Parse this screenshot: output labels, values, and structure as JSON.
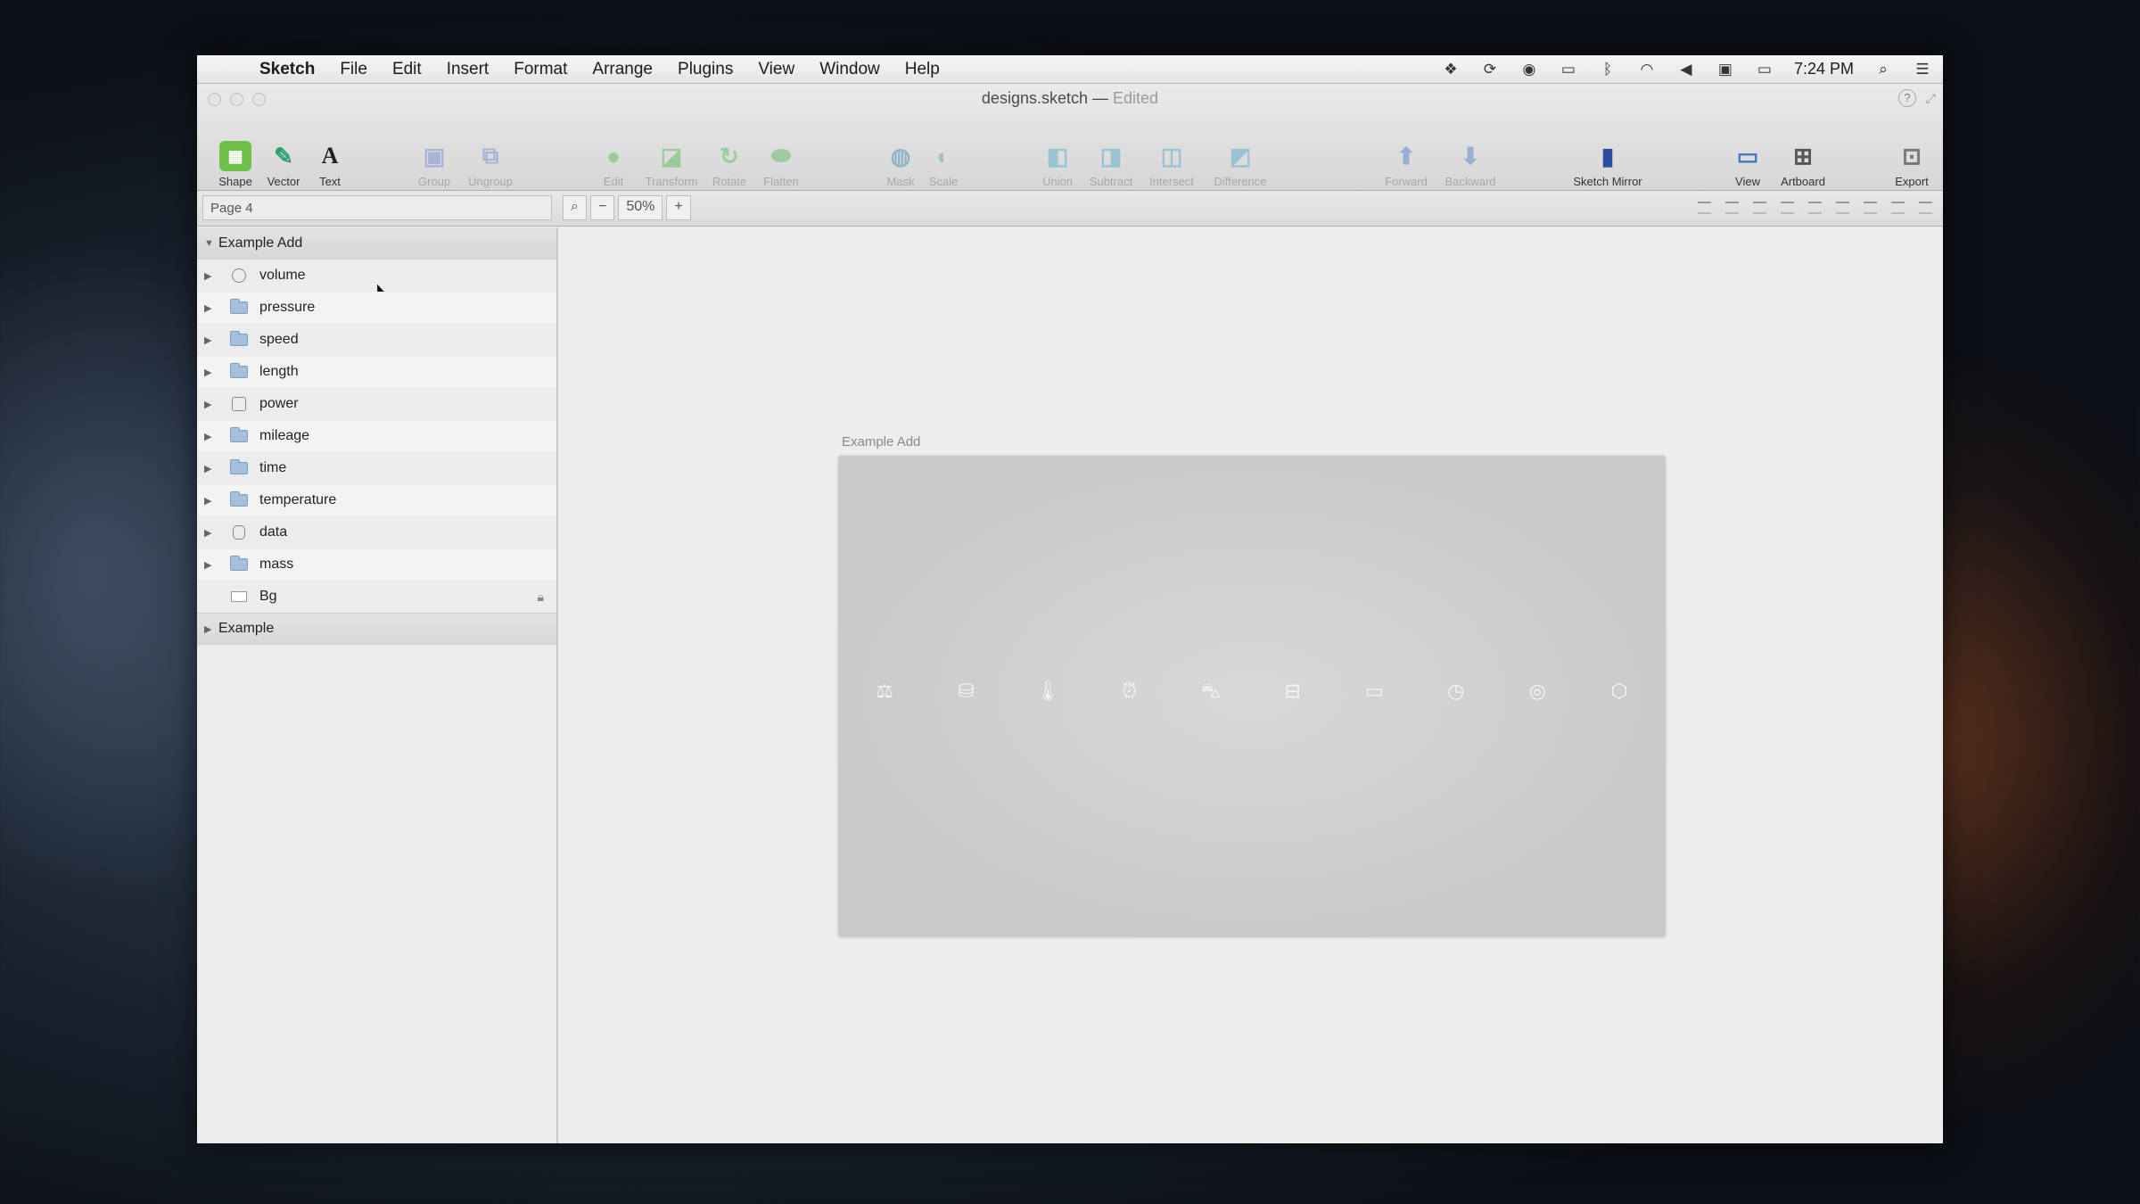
{
  "menubar": {
    "app": "Sketch",
    "items": [
      "File",
      "Edit",
      "Insert",
      "Format",
      "Arrange",
      "Plugins",
      "View",
      "Window",
      "Help"
    ],
    "clock": "7:24 PM",
    "status_icons": [
      "dropbox-icon",
      "sync-icon",
      "record-icon",
      "airplay-icon",
      "bluetooth-icon",
      "wifi-icon",
      "volume-icon",
      "display-icon",
      "battery-icon",
      "spotlight-icon",
      "notifications-icon"
    ]
  },
  "window": {
    "title": "designs.sketch",
    "title_sep": " — ",
    "status": "Edited"
  },
  "toolbar": {
    "shape": "Shape",
    "vector": "Vector",
    "text": "Text",
    "group": "Group",
    "ungroup": "Ungroup",
    "edit": "Edit",
    "transform": "Transform",
    "rotate": "Rotate",
    "flatten": "Flatten",
    "mask": "Mask",
    "scale": "Scale",
    "union": "Union",
    "subtract": "Subtract",
    "intersect": "Intersect",
    "difference": "Difference",
    "forward": "Forward",
    "backward": "Backward",
    "sketch_mirror": "Sketch Mirror",
    "view": "View",
    "artboard": "Artboard",
    "export": "Export"
  },
  "subbar": {
    "page": "Page 4",
    "zoom_minus": "−",
    "zoom_level": "50%",
    "zoom_plus": "+"
  },
  "layers": {
    "group_title": "Example Add",
    "items": [
      {
        "label": "volume",
        "icon": "symbol"
      },
      {
        "label": "pressure",
        "icon": "folder"
      },
      {
        "label": "speed",
        "icon": "folder"
      },
      {
        "label": "length",
        "icon": "folder"
      },
      {
        "label": "power",
        "icon": "symbol"
      },
      {
        "label": "mileage",
        "icon": "folder"
      },
      {
        "label": "time",
        "icon": "folder"
      },
      {
        "label": "temperature",
        "icon": "folder"
      },
      {
        "label": "data",
        "icon": "cylinder"
      },
      {
        "label": "mass",
        "icon": "folder"
      },
      {
        "label": "Bg",
        "icon": "rectangle"
      }
    ],
    "group2_title": "Example"
  },
  "canvas": {
    "artboard_title": "Example Add",
    "icons": [
      "mass-icon",
      "data-icon",
      "temperature-icon",
      "time-icon",
      "mileage-icon",
      "power-icon",
      "length-icon",
      "speed-icon",
      "pressure-icon",
      "volume-icon"
    ]
  }
}
